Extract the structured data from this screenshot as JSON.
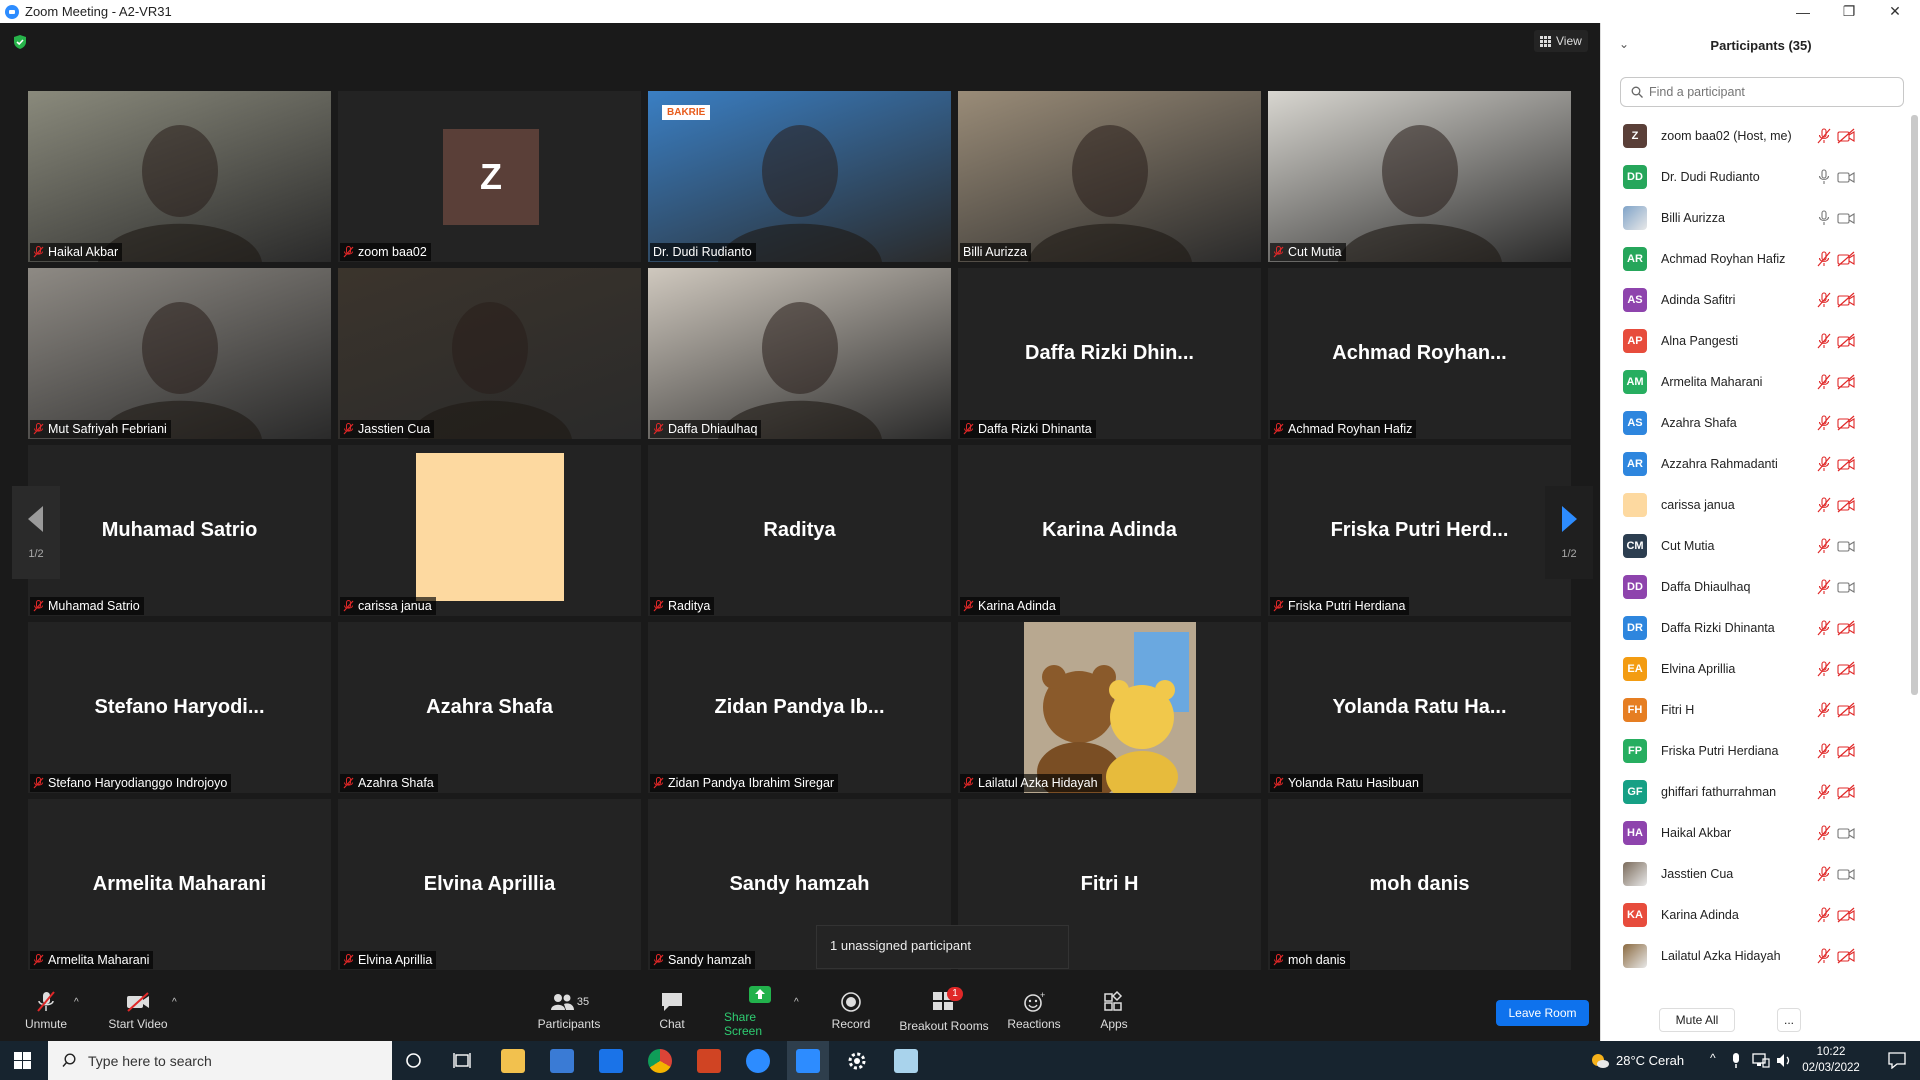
{
  "window": {
    "title": "Zoom Meeting - A2-VR31"
  },
  "meeting": {
    "view_label": "View"
  },
  "tiles": [
    {
      "id": "haikal",
      "label": "Haikal Akbar",
      "muted": true,
      "type": "video",
      "bg": "#8a8a7c"
    },
    {
      "id": "zoom-baa02",
      "label": "zoom baa02",
      "muted": true,
      "type": "avatar",
      "initial": "Z"
    },
    {
      "id": "dudi",
      "label": "Dr. Dudi Rudianto",
      "muted": false,
      "type": "video",
      "bg": "#3a7fc4",
      "active": true,
      "brand": "BAKRIE"
    },
    {
      "id": "billi",
      "label": "Billi Aurizza",
      "muted": false,
      "type": "video",
      "bg": "#9a8c78"
    },
    {
      "id": "cut",
      "label": "Cut Mutia",
      "muted": true,
      "type": "video",
      "bg": "#d8d6d0"
    },
    {
      "id": "mut",
      "label": "Mut Safriyah Febriani",
      "muted": true,
      "type": "video",
      "bg": "#8e8a84"
    },
    {
      "id": "jasstien",
      "label": "Jasstien Cua",
      "muted": true,
      "type": "video",
      "bg": "#3b342c"
    },
    {
      "id": "daffa-d",
      "label": "Daffa Dhiaulhaq",
      "muted": true,
      "type": "video",
      "bg": "#cfc8be"
    },
    {
      "id": "daffa-r",
      "label": "Daffa Rizki Dhinanta",
      "muted": true,
      "type": "name",
      "bigname": "Daffa Rizki Dhin..."
    },
    {
      "id": "achmad",
      "label": "Achmad Royhan Hafiz",
      "muted": true,
      "type": "name",
      "bigname": "Achmad Royhan..."
    },
    {
      "id": "muhamad",
      "label": "Muhamad Satrio",
      "muted": true,
      "type": "name",
      "bigname": "Muhamad Satrio"
    },
    {
      "id": "carissa",
      "label": "carissa janua",
      "muted": true,
      "type": "color",
      "color": "#fdd9a0"
    },
    {
      "id": "raditya",
      "label": "Raditya",
      "muted": true,
      "type": "name",
      "bigname": "Raditya"
    },
    {
      "id": "karina",
      "label": "Karina Adinda",
      "muted": true,
      "type": "name",
      "bigname": "Karina Adinda"
    },
    {
      "id": "friska",
      "label": "Friska Putri Herdiana",
      "muted": true,
      "type": "name",
      "bigname": "Friska Putri Herd..."
    },
    {
      "id": "stefano",
      "label": "Stefano Haryodianggo Indrojoyo",
      "muted": true,
      "type": "name",
      "bigname": "Stefano Haryodi..."
    },
    {
      "id": "azahra",
      "label": "Azahra Shafa",
      "muted": true,
      "type": "name",
      "bigname": "Azahra Shafa"
    },
    {
      "id": "zidan",
      "label": "Zidan Pandya Ibrahim Siregar",
      "muted": true,
      "type": "name",
      "bigname": "Zidan Pandya Ib..."
    },
    {
      "id": "lailatul",
      "label": "Lailatul Azka Hidayah",
      "muted": true,
      "type": "bears"
    },
    {
      "id": "yolanda",
      "label": "Yolanda Ratu Hasibuan",
      "muted": true,
      "type": "name",
      "bigname": "Yolanda Ratu Ha..."
    },
    {
      "id": "armelita",
      "label": "Armelita Maharani",
      "muted": true,
      "type": "name",
      "bigname": "Armelita Maharani"
    },
    {
      "id": "elvina",
      "label": "Elvina Aprillia",
      "muted": true,
      "type": "name",
      "bigname": "Elvina Aprillia"
    },
    {
      "id": "sandy",
      "label": "Sandy hamzah",
      "muted": true,
      "type": "name",
      "bigname": "Sandy hamzah"
    },
    {
      "id": "fitri",
      "label": "Fitri H",
      "muted": false,
      "type": "name",
      "bigname": "Fitri H"
    },
    {
      "id": "moh",
      "label": "moh danis",
      "muted": true,
      "type": "name",
      "bigname": "moh danis"
    }
  ],
  "pager": {
    "left_label": "1/2",
    "right_label": "1/2"
  },
  "toolbar": {
    "unmute": "Unmute",
    "start_video": "Start Video",
    "participants": "Participants",
    "participants_count": "35",
    "chat": "Chat",
    "share_screen": "Share Screen",
    "record": "Record",
    "breakout_rooms": "Breakout Rooms",
    "breakout_badge": "1",
    "reactions": "Reactions",
    "apps": "Apps",
    "leave_room": "Leave Room"
  },
  "tooltip": {
    "unassigned": "1 unassigned participant"
  },
  "panel": {
    "title": "Participants (35)",
    "search_placeholder": "Find a participant",
    "mute_all": "Mute All",
    "more": "...",
    "participants": [
      {
        "initials": "Z",
        "name": "zoom baa02 (Host, me)",
        "color": "#5a3f38",
        "mic": "muted",
        "cam": "off"
      },
      {
        "initials": "DD",
        "name": "Dr. Dudi Rudianto",
        "color": "#26a65b",
        "mic": "on",
        "cam": "on"
      },
      {
        "initials": "",
        "name": "Billi Aurizza",
        "color": "#7fa3c8",
        "mic": "on",
        "cam": "on",
        "pic": true
      },
      {
        "initials": "AR",
        "name": "Achmad Royhan Hafiz",
        "color": "#26a65b",
        "mic": "muted",
        "cam": "off"
      },
      {
        "initials": "AS",
        "name": "Adinda Safitri",
        "color": "#8e44ad",
        "mic": "muted",
        "cam": "off"
      },
      {
        "initials": "AP",
        "name": "Alna Pangesti",
        "color": "#e74c3c",
        "mic": "muted",
        "cam": "off"
      },
      {
        "initials": "AM",
        "name": "Armelita Maharani",
        "color": "#27ae60",
        "mic": "muted",
        "cam": "off"
      },
      {
        "initials": "AS",
        "name": "Azahra Shafa",
        "color": "#2e86de",
        "mic": "muted",
        "cam": "off"
      },
      {
        "initials": "AR",
        "name": "Azzahra Rahmadanti",
        "color": "#2e86de",
        "mic": "muted",
        "cam": "off"
      },
      {
        "initials": "",
        "name": "carissa janua",
        "color": "#fdd9a0",
        "mic": "muted",
        "cam": "off"
      },
      {
        "initials": "CM",
        "name": "Cut Mutia",
        "color": "#2c3e50",
        "mic": "muted",
        "cam": "on"
      },
      {
        "initials": "DD",
        "name": "Daffa Dhiaulhaq",
        "color": "#8e44ad",
        "mic": "muted",
        "cam": "on"
      },
      {
        "initials": "DR",
        "name": "Daffa Rizki Dhinanta",
        "color": "#2e86de",
        "mic": "muted",
        "cam": "off"
      },
      {
        "initials": "EA",
        "name": "Elvina Aprillia",
        "color": "#f39c12",
        "mic": "muted",
        "cam": "off"
      },
      {
        "initials": "FH",
        "name": "Fitri H",
        "color": "#e67e22",
        "mic": "muted",
        "cam": "off"
      },
      {
        "initials": "FP",
        "name": "Friska Putri Herdiana",
        "color": "#27ae60",
        "mic": "muted",
        "cam": "off"
      },
      {
        "initials": "GF",
        "name": "ghiffari fathurrahman",
        "color": "#16a085",
        "mic": "muted",
        "cam": "off"
      },
      {
        "initials": "HA",
        "name": "Haikal Akbar",
        "color": "#8e44ad",
        "mic": "muted",
        "cam": "on"
      },
      {
        "initials": "",
        "name": "Jasstien Cua",
        "color": "#7a6a5a",
        "mic": "muted",
        "cam": "on",
        "pic": true
      },
      {
        "initials": "KA",
        "name": "Karina Adinda",
        "color": "#e74c3c",
        "mic": "muted",
        "cam": "off"
      },
      {
        "initials": "",
        "name": "Lailatul Azka Hidayah",
        "color": "#8b6a40",
        "mic": "muted",
        "cam": "off",
        "pic": true
      }
    ]
  },
  "taskbar": {
    "search_placeholder": "Type here to search",
    "weather": "28°C  Cerah",
    "time": "10:22",
    "date": "02/03/2022"
  },
  "colors": {
    "accent": "#0e72ed",
    "muted_red": "#e02828",
    "active_speaker": "#f5e14b"
  }
}
